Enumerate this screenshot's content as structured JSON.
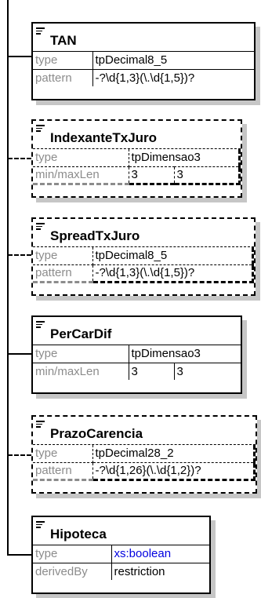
{
  "elements": [
    {
      "name": "TAN",
      "rows": [
        {
          "key": "type",
          "values": [
            "tpDecimal8_5"
          ]
        },
        {
          "key": "pattern",
          "values": [
            "-?\\d{1,3}(\\.\\d{1,5})?"
          ]
        }
      ]
    },
    {
      "name": "IndexanteTxJuro",
      "rows": [
        {
          "key": "type",
          "values": [
            "tpDimensao3"
          ]
        },
        {
          "key": "min/maxLen",
          "values": [
            "3",
            "3"
          ]
        }
      ]
    },
    {
      "name": "SpreadTxJuro",
      "rows": [
        {
          "key": "type",
          "values": [
            "tpDecimal8_5"
          ]
        },
        {
          "key": "pattern",
          "values": [
            "-?\\d{1,3}(\\.\\d{1,5})?"
          ]
        }
      ]
    },
    {
      "name": "PerCarDif",
      "rows": [
        {
          "key": "type",
          "values": [
            "tpDimensao3"
          ]
        },
        {
          "key": "min/maxLen",
          "values": [
            "3",
            "3"
          ]
        }
      ]
    },
    {
      "name": "PrazoCarencia",
      "rows": [
        {
          "key": "type",
          "values": [
            "tpDecimal28_2"
          ]
        },
        {
          "key": "pattern",
          "values": [
            "-?\\d{1,26}(\\.\\d{1,2})?"
          ]
        }
      ]
    },
    {
      "name": "Hipoteca",
      "rows": [
        {
          "key": "type",
          "values": [
            "xs:boolean"
          ]
        },
        {
          "key": "derivedBy",
          "values": [
            "restriction"
          ]
        }
      ]
    }
  ],
  "colors": {
    "key_text": "#8c8c8c",
    "builtin_type_text": "#0000e0",
    "shadow": "#c6c6c6"
  }
}
